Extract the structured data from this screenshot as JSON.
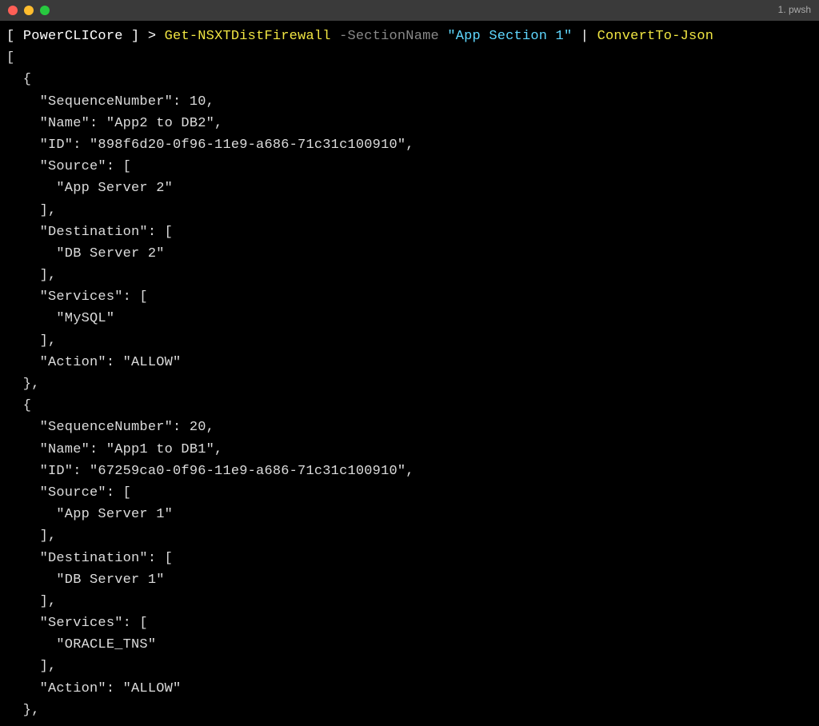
{
  "window": {
    "title": "1. pwsh"
  },
  "prompt": {
    "bracket_open": "[ ",
    "context": "PowerCLICore",
    "bracket_close": " ] > ",
    "cmd1": "Get-NSXTDistFirewall ",
    "param_name": "-SectionName ",
    "param_value": "\"App Section 1\"",
    "pipe": " | ",
    "cmd2": "ConvertTo-Json"
  },
  "output": {
    "line0": "[",
    "line1": "  {",
    "line2": "    \"SequenceNumber\": 10,",
    "line3": "    \"Name\": \"App2 to DB2\",",
    "line4": "    \"ID\": \"898f6d20-0f96-11e9-a686-71c31c100910\",",
    "line5": "    \"Source\": [",
    "line6": "      \"App Server 2\"",
    "line7": "    ],",
    "line8": "    \"Destination\": [",
    "line9": "      \"DB Server 2\"",
    "line10": "    ],",
    "line11": "    \"Services\": [",
    "line12": "      \"MySQL\"",
    "line13": "    ],",
    "line14": "    \"Action\": \"ALLOW\"",
    "line15": "  },",
    "line16": "  {",
    "line17": "    \"SequenceNumber\": 20,",
    "line18": "    \"Name\": \"App1 to DB1\",",
    "line19": "    \"ID\": \"67259ca0-0f96-11e9-a686-71c31c100910\",",
    "line20": "    \"Source\": [",
    "line21": "      \"App Server 1\"",
    "line22": "    ],",
    "line23": "    \"Destination\": [",
    "line24": "      \"DB Server 1\"",
    "line25": "    ],",
    "line26": "    \"Services\": [",
    "line27": "      \"ORACLE_TNS\"",
    "line28": "    ],",
    "line29": "    \"Action\": \"ALLOW\"",
    "line30": "  },"
  }
}
